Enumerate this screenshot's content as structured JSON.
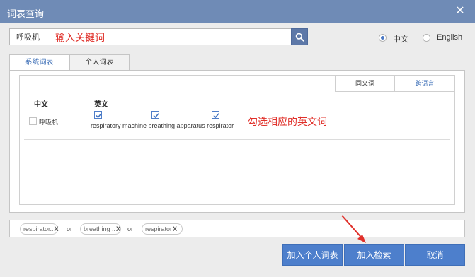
{
  "window": {
    "title": "词表查询",
    "close_icon": "close-icon"
  },
  "search": {
    "value": "呼吸机",
    "annotation": "输入关键词",
    "button_icon": "search-icon"
  },
  "language": {
    "options": [
      {
        "label": "中文",
        "selected": true
      },
      {
        "label": "English",
        "selected": false
      }
    ]
  },
  "tabs": [
    {
      "label": "系统词表",
      "active": true
    },
    {
      "label": "个人词表",
      "active": false
    }
  ],
  "subtabs": [
    {
      "label": "同义词"
    },
    {
      "label": "跨语言"
    }
  ],
  "table": {
    "col_cn": "中文",
    "col_en": "英文",
    "rows": [
      {
        "cn": "呼吸机",
        "cn_checked": false,
        "en_terms": "respiratory machine breathing apparatus respirator",
        "en_checked": [
          true,
          true,
          true
        ]
      }
    ],
    "annotation": "勾选相应的英文词"
  },
  "chips": [
    {
      "label": "respirator..",
      "remove": "X"
    },
    {
      "label": "breathing ..",
      "remove": "X"
    },
    {
      "label": "respirator",
      "remove": "X"
    }
  ],
  "connector": "or",
  "buttons": {
    "add_personal": "加入个人词表",
    "add_search": "加入检索",
    "cancel": "取消"
  },
  "colors": {
    "titlebar": "#6f8bb6",
    "accent": "#4d7fcc",
    "annotation": "#e0302a"
  }
}
